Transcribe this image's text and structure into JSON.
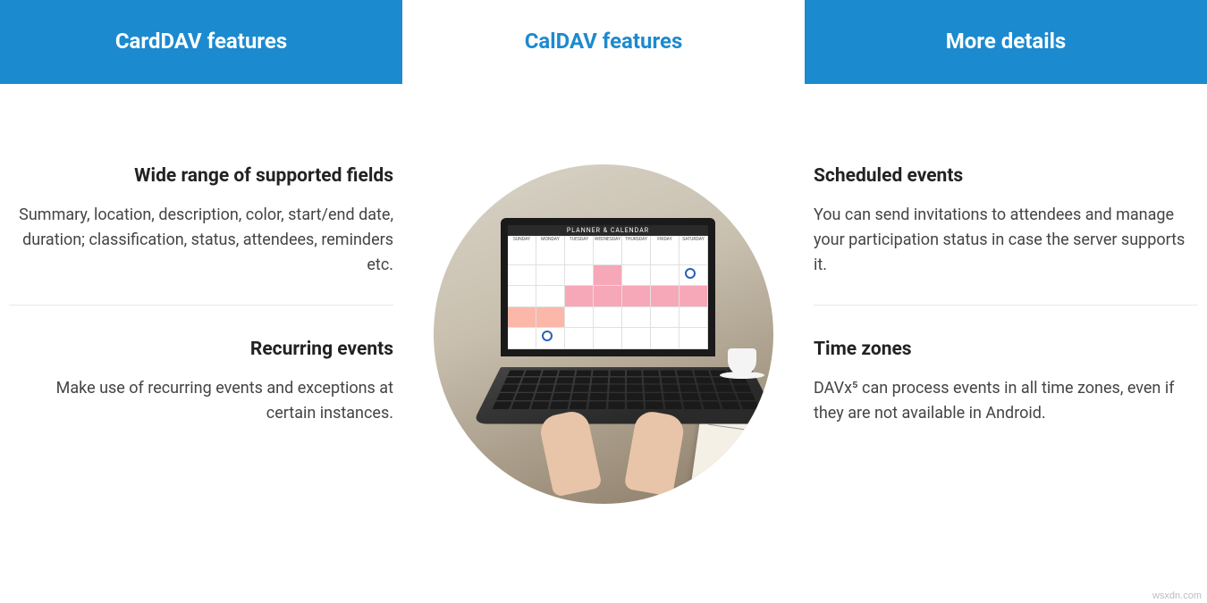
{
  "tabs": [
    {
      "label": "CardDAV features",
      "active": false
    },
    {
      "label": "CalDAV features",
      "active": true
    },
    {
      "label": "More details",
      "active": false
    }
  ],
  "left_features": [
    {
      "title": "Wide range of supported fields",
      "desc": "Summary, location, description, color, start/end date, duration; classification, status, attendees, reminders etc."
    },
    {
      "title": "Recurring events",
      "desc": "Make use of recurring events and exceptions at certain instances."
    }
  ],
  "right_features": [
    {
      "title": "Scheduled events",
      "desc": "You can send invitations to attendees and manage your participation status in case the server supports it."
    },
    {
      "title": "Time zones",
      "desc": "DAVx⁵ can process events in all time zones, even if they are not available in Android."
    }
  ],
  "calendar": {
    "header": "PLANNER & CALENDAR",
    "days": [
      "SUNDAY",
      "MONDAY",
      "TUESDAY",
      "WEDNESDAY",
      "THURSDAY",
      "FRIDAY",
      "SATURDAY"
    ]
  },
  "watermark": "wsxdn.com"
}
